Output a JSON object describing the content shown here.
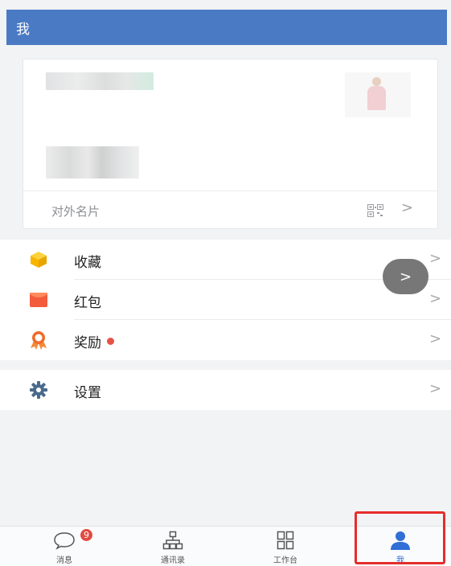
{
  "header": {
    "title": "我"
  },
  "profile_card": {
    "external_card_label": "对外名片",
    "chevron": ">"
  },
  "menu_group_1": {
    "items": [
      {
        "label": "收藏",
        "icon": "box-icon",
        "color": "#f7b500",
        "chevron": ">"
      },
      {
        "label": "红包",
        "icon": "red-envelope-icon",
        "color": "#f25c3b",
        "chevron": ">"
      },
      {
        "label": "奖励",
        "icon": "award-ribbon-icon",
        "color": "#ef6b2a",
        "chevron": ">",
        "badge_color": "#e55247"
      }
    ]
  },
  "menu_group_2": {
    "items": [
      {
        "label": "设置",
        "icon": "gear-icon",
        "color": "#4a6a8c",
        "chevron": ">"
      }
    ]
  },
  "floating_button": {
    "label": ">"
  },
  "tabbar": {
    "tabs": [
      {
        "label": "消息",
        "icon": "chat-bubble-icon",
        "badge": "9"
      },
      {
        "label": "通讯录",
        "icon": "org-chart-icon"
      },
      {
        "label": "工作台",
        "icon": "grid-icon"
      },
      {
        "label": "我",
        "icon": "person-icon",
        "active": true
      }
    ]
  },
  "colors": {
    "header_bg": "#4a7ac4",
    "active_tab": "#2f6fd6",
    "highlight_border": "#e52d2b"
  }
}
